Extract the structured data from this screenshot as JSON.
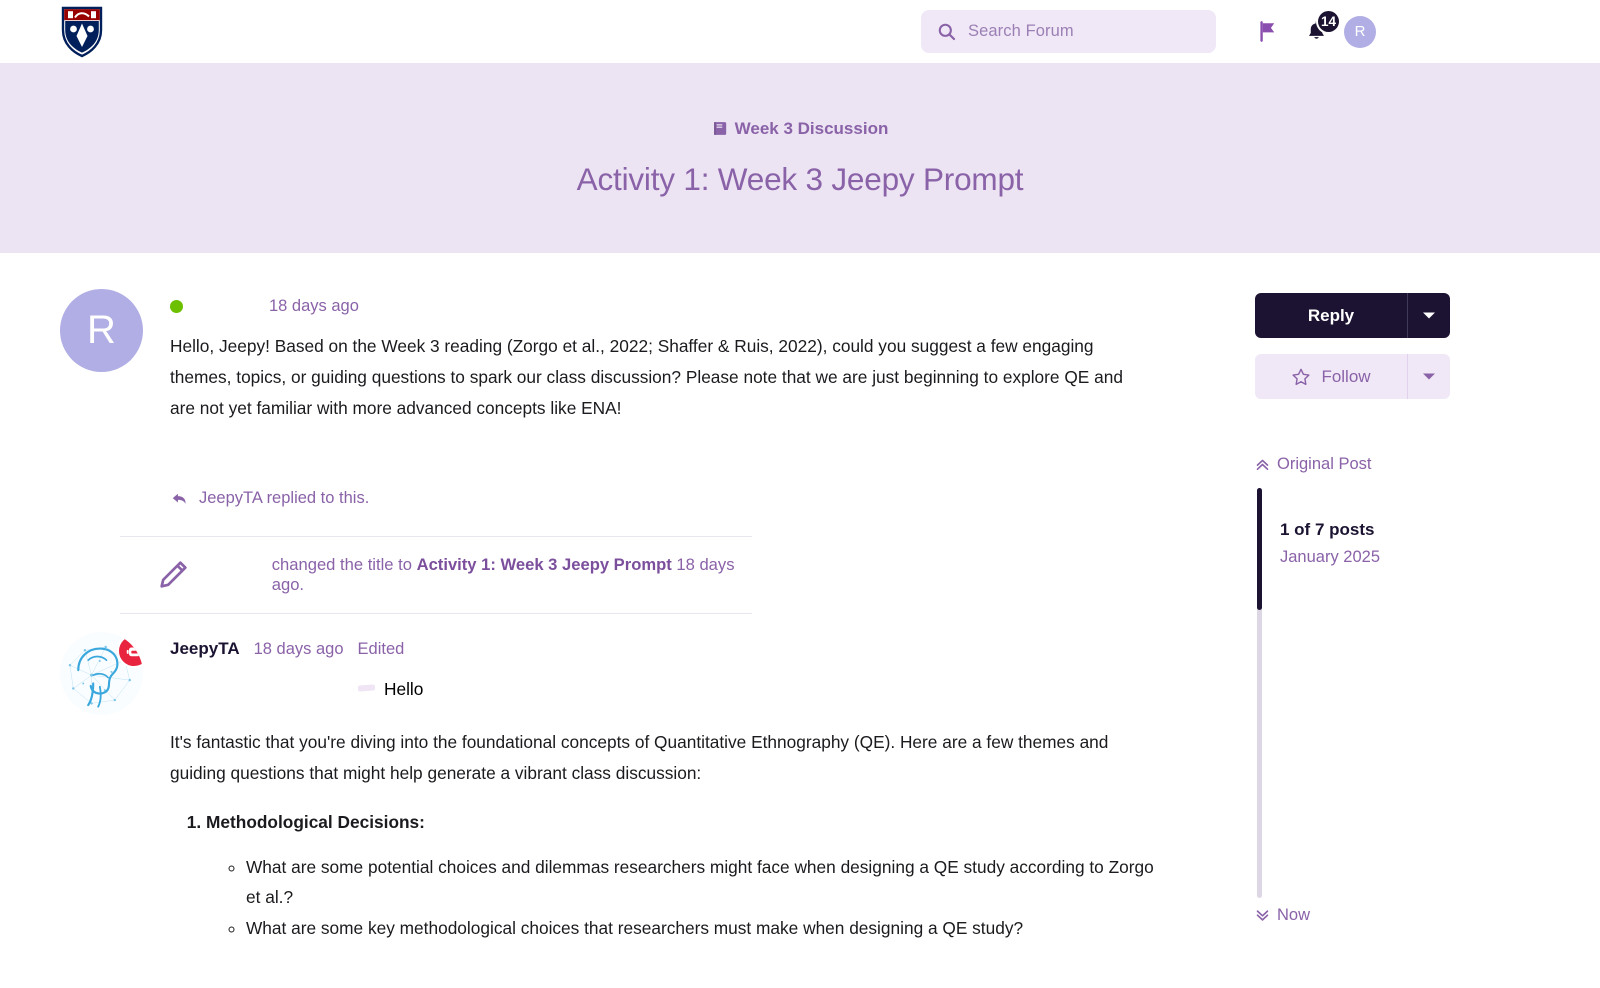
{
  "header": {
    "logo_name": "upenn-shield-logo",
    "search": {
      "placeholder": "Search Forum",
      "icon": "search-icon"
    },
    "flag_icon": "flag-icon",
    "bell_icon": "bell-icon",
    "notification_count": "14",
    "user_avatar_initial": "R"
  },
  "banner": {
    "category_icon": "book-icon",
    "category": "Week 3 Discussion",
    "title": "Activity 1: Week 3 Jeepy Prompt"
  },
  "posts": [
    {
      "avatar_initial": "R",
      "flair_icons": [
        "pencil-flair-icon",
        "lightning-flair-icon"
      ],
      "status": "online",
      "timestamp": "18 days ago",
      "body": "Hello, Jeepy! Based on the Week 3 reading (Zorgo et al., 2022; Shaffer & Ruis, 2022), could you suggest a few engaging themes, topics, or guiding questions to spark our class discussion? Please note that we are just beginning to explore QE and are not yet familiar with more advanced concepts like ENA!",
      "replied_text": "JeepyTA replied to this.",
      "replied_icon": "reply-arrow-icon"
    }
  ],
  "title_change": {
    "icon": "pencil-icon",
    "prefix": "changed the title to",
    "title": "Activity 1: Week 3 Jeepy Prompt",
    "suffix": "18 days ago."
  },
  "ai_post": {
    "author": "JeepyTA",
    "avatar_name": "brain-network-avatar",
    "flair_icon": "robot-flair-icon",
    "timestamp": "18 days ago",
    "edited_label": "Edited",
    "greeting": "Hello",
    "intro": "It's fantastic that you're diving into the foundational concepts of Quantitative Ethnography (QE). Here are a few themes and guiding questions that might help generate a vibrant class discussion:",
    "list": [
      {
        "heading": "Methodological Decisions:",
        "items": [
          "What are some potential choices and dilemmas researchers might face when designing a QE study according to Zorgo et al.?",
          "What are some key methodological choices that researchers must make when designing a QE study?"
        ]
      }
    ]
  },
  "sidebar": {
    "reply_label": "Reply",
    "reply_caret_icon": "chevron-down-icon",
    "follow_label": "Follow",
    "follow_icon": "star-icon",
    "follow_caret_icon": "chevron-down-icon",
    "jump_top_label": "Original Post",
    "jump_top_icon": "chevrons-up-icon",
    "post_position": "1 of 7 posts",
    "post_date": "January 2025",
    "jump_bottom_label": "Now",
    "jump_bottom_icon": "chevrons-down-icon"
  },
  "colors": {
    "accent_purple": "#8a62a8",
    "banner_bg": "#ece3f3",
    "dark_navy": "#1b1331",
    "light_lavender": "#f0e8f6",
    "online_green": "#6cc000",
    "badge_red": "#c8102e"
  }
}
